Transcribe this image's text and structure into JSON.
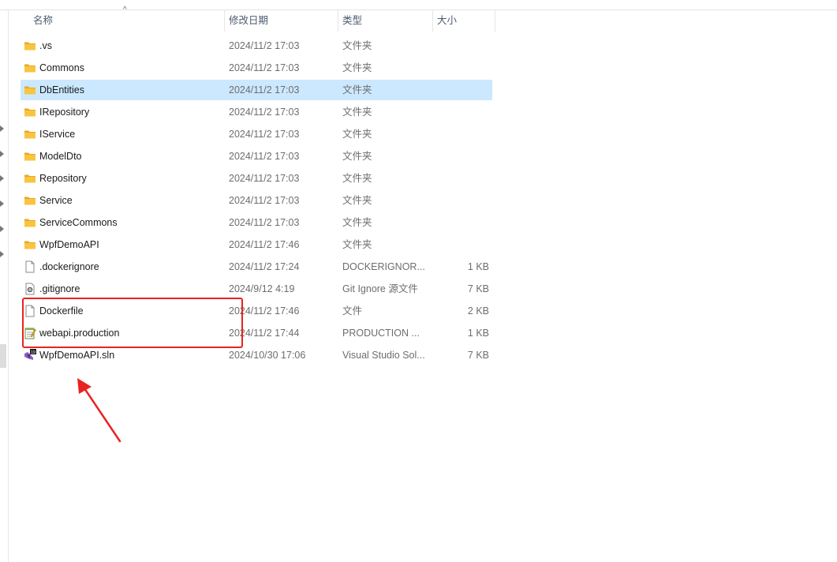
{
  "header": {
    "name_label": "名称",
    "date_label": "修改日期",
    "type_label": "类型",
    "size_label": "大小",
    "sort_indicator": "^"
  },
  "rows": [
    {
      "name": ".vs",
      "date": "2024/11/2 17:03",
      "type": "文件夹",
      "size": "",
      "icon": "folder-icon",
      "selected": false
    },
    {
      "name": "Commons",
      "date": "2024/11/2 17:03",
      "type": "文件夹",
      "size": "",
      "icon": "folder-icon",
      "selected": false
    },
    {
      "name": "DbEntities",
      "date": "2024/11/2 17:03",
      "type": "文件夹",
      "size": "",
      "icon": "folder-icon",
      "selected": true
    },
    {
      "name": "IRepository",
      "date": "2024/11/2 17:03",
      "type": "文件夹",
      "size": "",
      "icon": "folder-icon",
      "selected": false
    },
    {
      "name": "IService",
      "date": "2024/11/2 17:03",
      "type": "文件夹",
      "size": "",
      "icon": "folder-icon",
      "selected": false
    },
    {
      "name": "ModelDto",
      "date": "2024/11/2 17:03",
      "type": "文件夹",
      "size": "",
      "icon": "folder-icon",
      "selected": false
    },
    {
      "name": "Repository",
      "date": "2024/11/2 17:03",
      "type": "文件夹",
      "size": "",
      "icon": "folder-icon",
      "selected": false
    },
    {
      "name": "Service",
      "date": "2024/11/2 17:03",
      "type": "文件夹",
      "size": "",
      "icon": "folder-icon",
      "selected": false
    },
    {
      "name": "ServiceCommons",
      "date": "2024/11/2 17:03",
      "type": "文件夹",
      "size": "",
      "icon": "folder-icon",
      "selected": false
    },
    {
      "name": "WpfDemoAPI",
      "date": "2024/11/2 17:46",
      "type": "文件夹",
      "size": "",
      "icon": "folder-icon",
      "selected": false
    },
    {
      "name": ".dockerignore",
      "date": "2024/11/2 17:24",
      "type": "DOCKERIGNOR...",
      "size": "1 KB",
      "icon": "blank-file-icon",
      "selected": false
    },
    {
      "name": ".gitignore",
      "date": "2024/9/12 4:19",
      "type": "Git Ignore 源文件",
      "size": "7 KB",
      "icon": "config-file-icon",
      "selected": false
    },
    {
      "name": "Dockerfile",
      "date": "2024/11/2 17:46",
      "type": "文件",
      "size": "2 KB",
      "icon": "blank-file-icon",
      "selected": false
    },
    {
      "name": "webapi.production",
      "date": "2024/11/2 17:44",
      "type": "PRODUCTION ...",
      "size": "1 KB",
      "icon": "notepad-file-icon",
      "selected": false
    },
    {
      "name": "WpfDemoAPI.sln",
      "date": "2024/10/30 17:06",
      "type": "Visual Studio Sol...",
      "size": "7 KB",
      "icon": "visual-studio-solution-icon",
      "selected": false
    }
  ],
  "colors": {
    "selection": "#cce8ff",
    "annotation_red": "#e8231f",
    "folder_yellow": "#f8c540"
  }
}
